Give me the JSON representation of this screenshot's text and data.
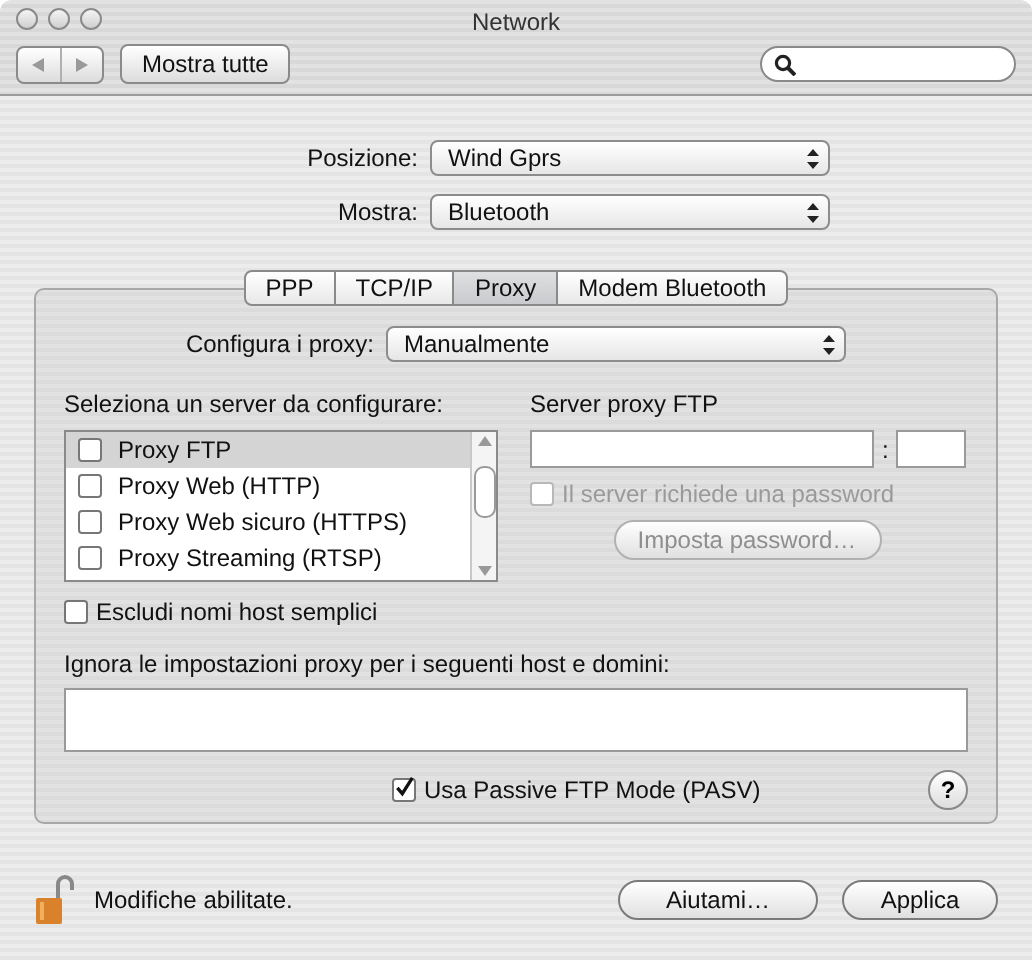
{
  "window": {
    "title": "Network"
  },
  "toolbar": {
    "show_all": "Mostra tutte"
  },
  "location": {
    "label": "Posizione:",
    "value": "Wind Gprs"
  },
  "show": {
    "label": "Mostra:",
    "value": "Bluetooth"
  },
  "tabs": [
    {
      "label": "PPP",
      "selected": false
    },
    {
      "label": "TCP/IP",
      "selected": false
    },
    {
      "label": "Proxy",
      "selected": true
    },
    {
      "label": "Modem Bluetooth",
      "selected": false
    }
  ],
  "proxy": {
    "configure_label": "Configura i proxy:",
    "configure_value": "Manualmente",
    "server_list_label": "Seleziona un server da configurare:",
    "servers": [
      {
        "label": "Proxy FTP",
        "checked": false,
        "selected": true
      },
      {
        "label": "Proxy Web (HTTP)",
        "checked": false,
        "selected": false
      },
      {
        "label": "Proxy Web sicuro (HTTPS)",
        "checked": false,
        "selected": false
      },
      {
        "label": "Proxy Streaming (RTSP)",
        "checked": false,
        "selected": false
      }
    ],
    "server_heading": "Server proxy FTP",
    "port_separator": ":",
    "password_required": {
      "label": "Il server richiede una password",
      "checked": false,
      "disabled": true
    },
    "set_password_button": {
      "label": "Imposta password…",
      "disabled": true
    },
    "exclude_simple": {
      "label": "Escludi nomi host semplici",
      "checked": false
    },
    "bypass_label": "Ignora le impostazioni proxy per i seguenti host e domini:",
    "passive_ftp": {
      "label": "Usa Passive FTP Mode (PASV)",
      "checked": true
    },
    "help": "?"
  },
  "footer": {
    "lock_label": "Modifiche abilitate.",
    "buttons": [
      {
        "label": "Aiutami…"
      },
      {
        "label": "Applica"
      }
    ]
  }
}
